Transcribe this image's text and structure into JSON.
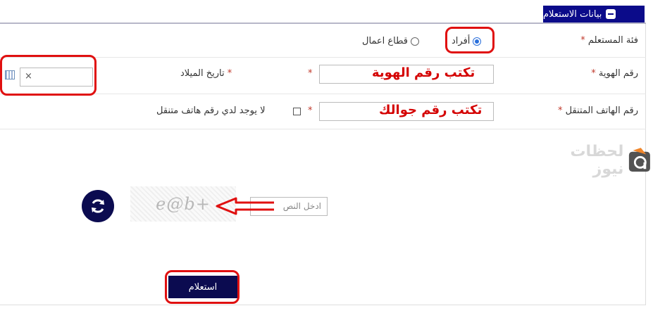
{
  "section": {
    "title": "بيانات الاستعلام"
  },
  "fields": {
    "user_type": {
      "label": "فئة المستعلم",
      "required": "*",
      "options": [
        {
          "label": "أفراد",
          "selected": true
        },
        {
          "label": "قطاع اعمال",
          "selected": false
        }
      ]
    },
    "id_number": {
      "label": "رقم الهوية",
      "required": "*",
      "hint": "تكتب رقم الهوية"
    },
    "birth_date": {
      "label": "تاريخ الميلاد",
      "required": "*",
      "clear": "×"
    },
    "mobile": {
      "label": "رقم الهاتف المتنقل",
      "required": "*",
      "hint": "تكتب رقم جوالك"
    },
    "no_mobile": {
      "label": "لا يوجد لدي رقم هاتف متنقل",
      "required": "*"
    }
  },
  "captcha": {
    "text": "e@b+",
    "input_placeholder": "ادخل النص"
  },
  "submit": {
    "label": "استعلام"
  },
  "watermark": {
    "text": "لحظات نيوز"
  },
  "colors": {
    "accent": "#0b0b8a",
    "button": "#0b0b50",
    "highlight": "#e01010",
    "hint": "#d40000"
  }
}
